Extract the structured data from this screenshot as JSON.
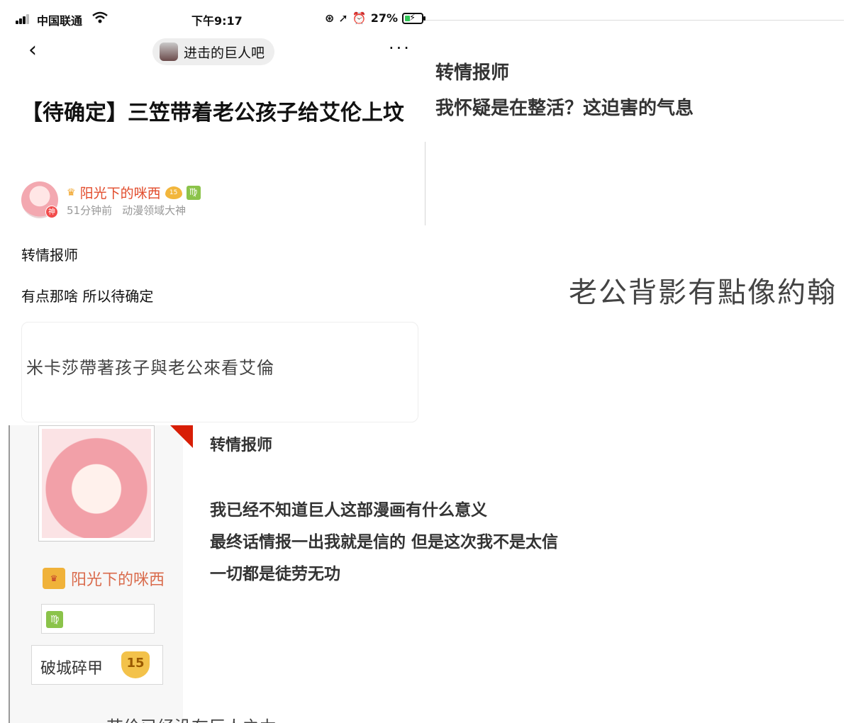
{
  "status_bar": {
    "carrier": "中国联通",
    "time": "下午9:17",
    "battery": "27%"
  },
  "nav": {
    "forum_name": "进击的巨人吧",
    "more": "···"
  },
  "post": {
    "title": "【待确定】三笠带着老公孩子给艾伦上坟",
    "author": "阳光下的咪西",
    "level": "15",
    "zodiac": "♍",
    "time_ago": "51分钟前",
    "user_title": "动漫领域大神",
    "god_badge": "神",
    "body_line_1": "转情报师",
    "body_line_2": "有点那啥 所以待确定",
    "quote": "米卡莎帶著孩子與老公來看艾倫"
  },
  "top_right": {
    "line_1": "转情报师",
    "line_2": "我怀疑是在整活？这迫害的气息",
    "caption": "老公背影有點像約翰"
  },
  "forum_post": {
    "user_name": "阳光下的咪西",
    "zodiac": "♍",
    "rank_title": "破城碎甲",
    "rank_level": "15",
    "author_line": "转情报师",
    "line_1": "我已经不知道巨人这部漫画有什么意义",
    "line_2": "最终话情报一出我就是信的 但是这次我不是太信",
    "line_3": "一切都是徒劳无功",
    "cut_off_line": "艾伦已经没有巨人之力"
  },
  "colors": {
    "author_name": "#e24b2b",
    "battery_fill": "#34c759",
    "ribbon": "#d81e06",
    "level_gem": "#f2b63c"
  }
}
